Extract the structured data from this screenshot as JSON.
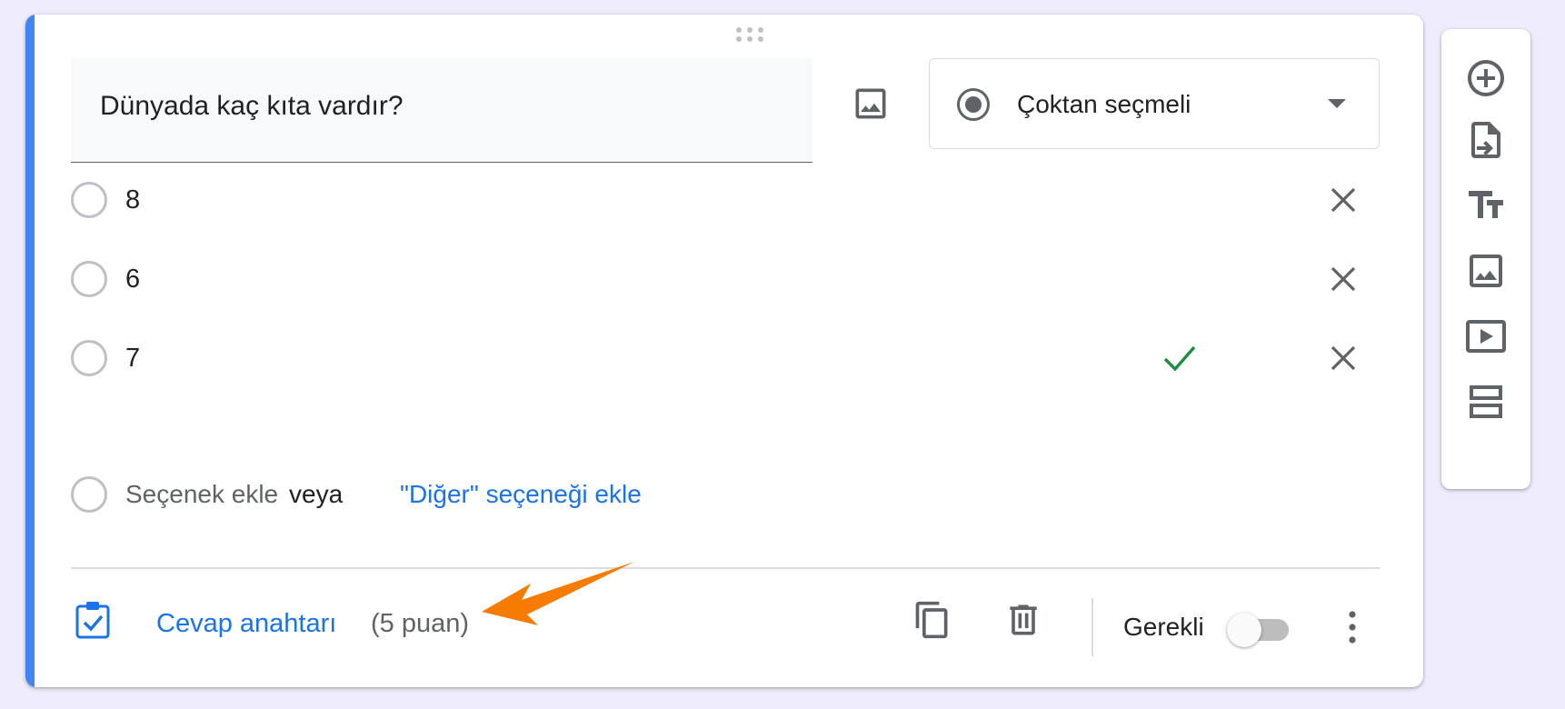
{
  "question": {
    "title": "Dünyada kaç kıta vardır?",
    "type_label": "Çoktan seçmeli"
  },
  "options": [
    {
      "label": "8",
      "correct": false
    },
    {
      "label": "6",
      "correct": false
    },
    {
      "label": "7",
      "correct": true
    }
  ],
  "add_option": {
    "add_label": "Seçenek ekle",
    "or_label": "veya",
    "other_label": "\"Diğer\" seçeneği ekle"
  },
  "footer": {
    "answer_key_label": "Cevap anahtarı",
    "points_label": "(5 puan)",
    "required_label": "Gerekli",
    "required_on": false
  },
  "toolbar": {
    "icons": [
      "add-question-icon",
      "import-questions-icon",
      "add-title-icon",
      "add-image-icon",
      "add-video-icon",
      "add-section-icon"
    ]
  },
  "colors": {
    "accent": "#4285f4",
    "link": "#1a73e8",
    "correct": "#1e8e3e",
    "annotation_arrow": "#f57c00",
    "background": "#efedfb"
  }
}
